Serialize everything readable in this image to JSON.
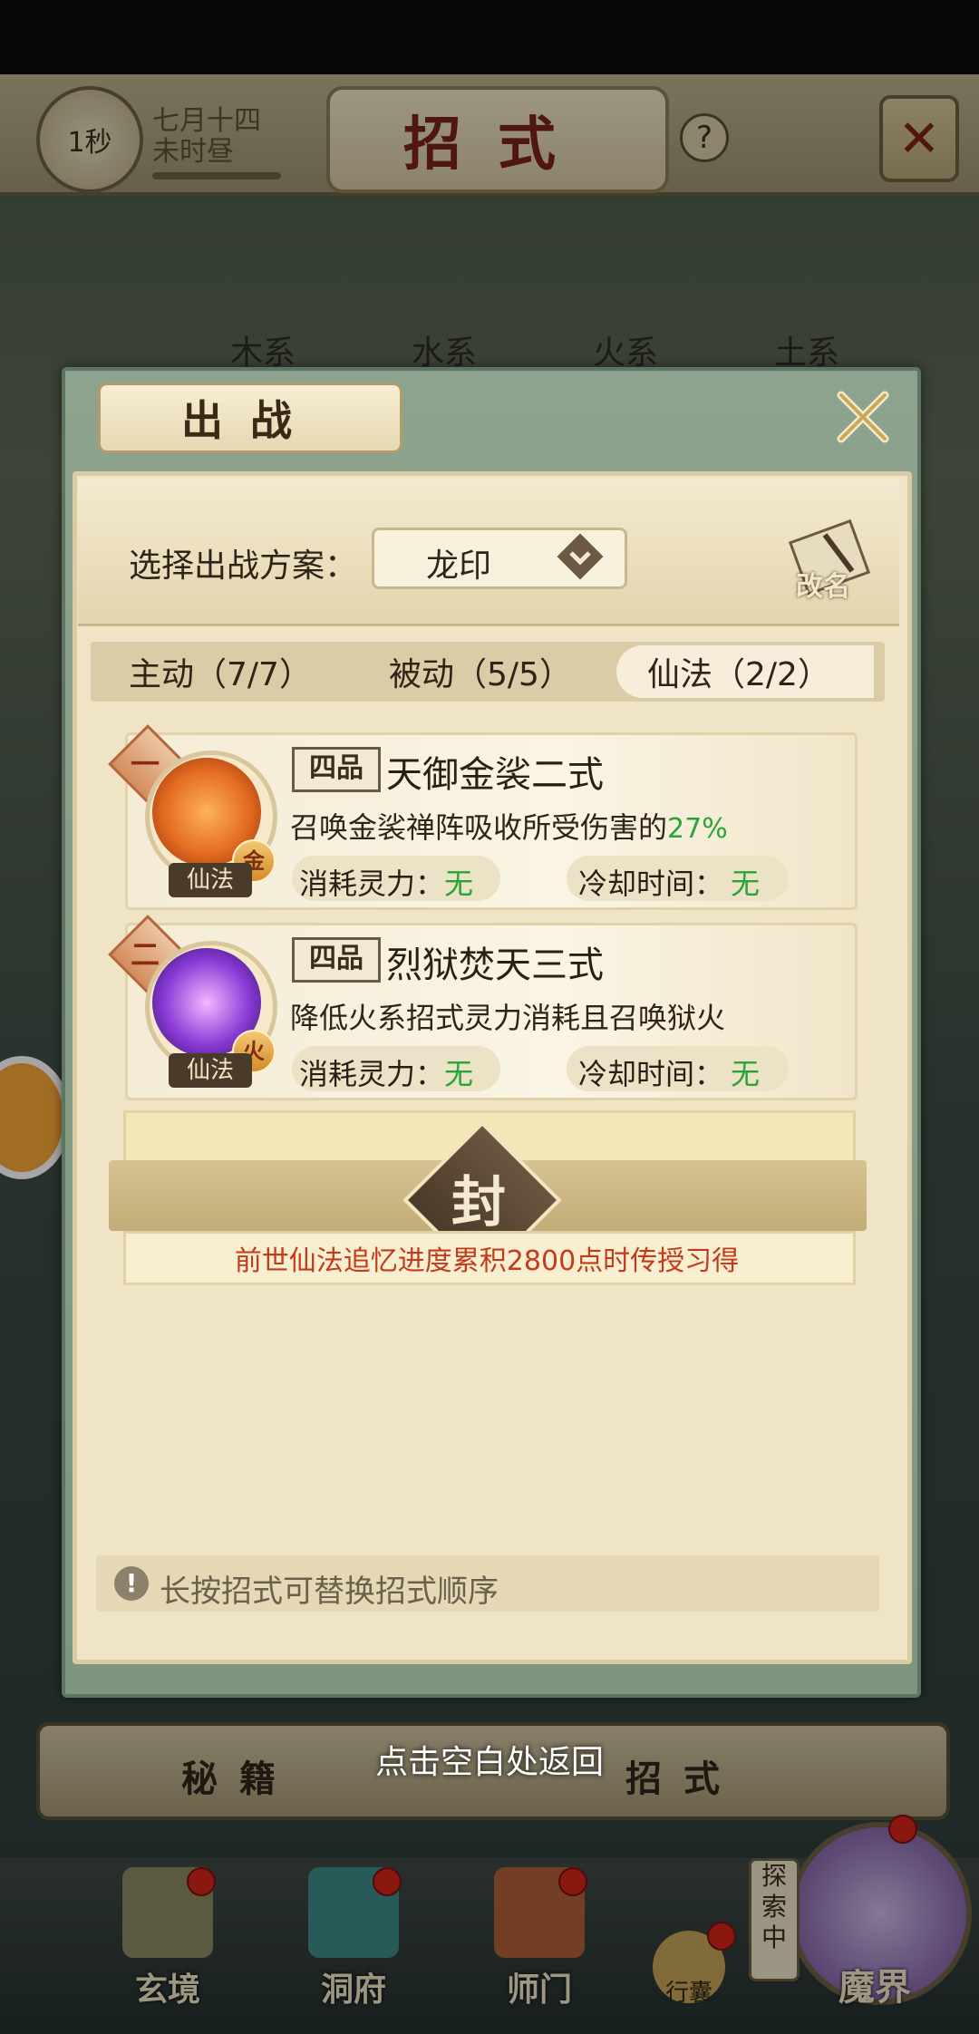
{
  "top_bar": {
    "timer": "1秒",
    "date_line1": "七月十四",
    "date_line2": "未时昼",
    "title": "招式",
    "help_symbol": "?",
    "close_symbol": "✕"
  },
  "bg_tabs": [
    "木系",
    "水系",
    "火系",
    "土系"
  ],
  "dialog": {
    "title": "出战",
    "close_icon": "close-x-icon",
    "plan_label": "选择出战方案：",
    "plan_value": "龙印",
    "rename_label": "改名",
    "tabs": [
      {
        "label": "主动（7/7）",
        "active": false
      },
      {
        "label": "被动（5/5）",
        "active": false
      },
      {
        "label": "仙法（2/2）",
        "active": true
      }
    ],
    "skills": [
      {
        "rank": "一",
        "grade": "四品",
        "name": "天御金裟二式",
        "desc_prefix": "召唤金裟禅阵吸收所受伤害的",
        "desc_highlight": "27%",
        "type_tag": "仙法",
        "element": "金",
        "cost_label": "消耗灵力：",
        "cost_value": "无",
        "cooldown_label": "冷却时间：",
        "cooldown_value": "无",
        "icon_color": "#e36b20"
      },
      {
        "rank": "二",
        "grade": "四品",
        "name": "烈狱焚天三式",
        "desc_prefix": "降低火系招式灵力消耗且召唤狱火",
        "desc_highlight": "",
        "type_tag": "仙法",
        "element": "火",
        "cost_label": "消耗灵力：",
        "cost_value": "无",
        "cooldown_label": "冷却时间：",
        "cooldown_value": "无",
        "icon_color": "#8b3bd6"
      }
    ],
    "sealed": {
      "char": "封",
      "text": "前世仙法追忆进度累积2800点时传授习得"
    },
    "hint": "长按招式可替换招式顺序"
  },
  "bottom": {
    "tab_left": "秘籍",
    "tab_right": "招式",
    "tap_hint": "点击空白处返回"
  },
  "nav": {
    "items": [
      "玄境",
      "洞府",
      "师门",
      "行囊",
      "魔界"
    ],
    "explore_badge": "探索中"
  }
}
